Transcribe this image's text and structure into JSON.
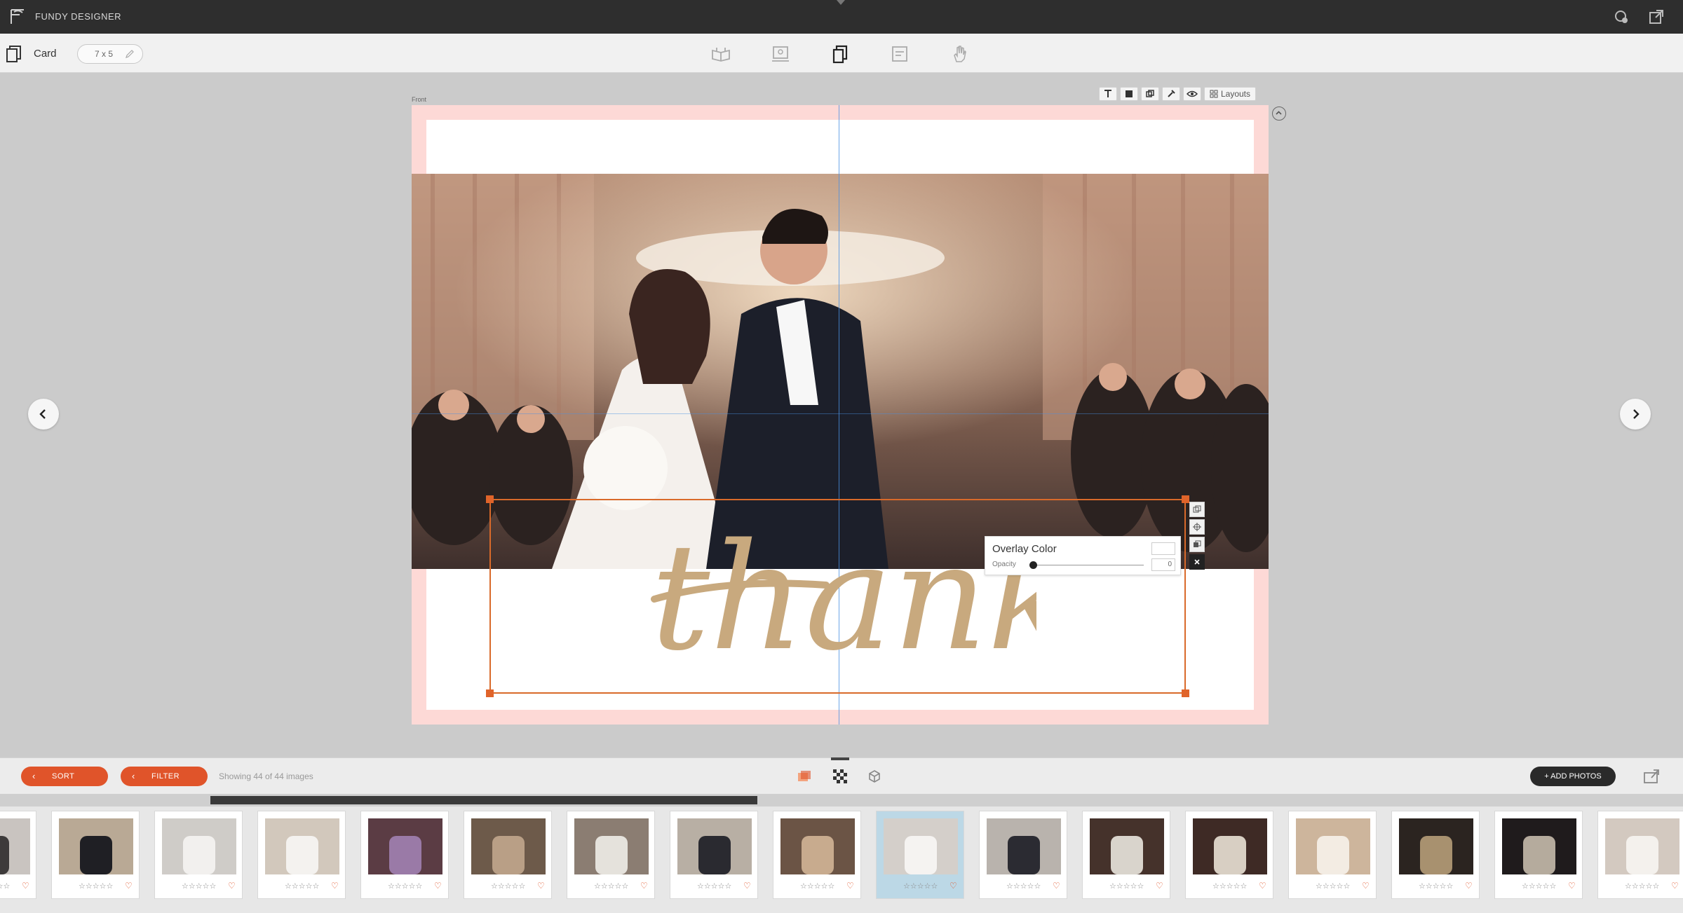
{
  "app": {
    "name": "FUNDY DESIGNER"
  },
  "toolbar": {
    "document_type": "Card",
    "size": "7 x 5",
    "modes": [
      "album-icon",
      "wall-art-icon",
      "card-icon",
      "gallery-icon",
      "hand-icon"
    ],
    "active_mode_index": 2
  },
  "canvas": {
    "side_label": "Front",
    "layouts_label": "Layouts",
    "text_overlay": "thanks"
  },
  "overlay_panel": {
    "title": "Overlay Color",
    "opacity_label": "Opacity",
    "opacity_value": "0"
  },
  "filmstrip_bar": {
    "sort_label": "SORT",
    "filter_label": "FILTER",
    "showing_text": "Showing 44 of 44 images",
    "add_photos_label": "+ ADD PHOTOS",
    "scroll_progress": 0.325
  },
  "thumbnails": {
    "selected_index": 9,
    "rating_stars": "☆☆☆☆☆",
    "items": [
      {
        "subject": "partial",
        "colors": [
          "#c9c4c0",
          "#3d3a3a"
        ]
      },
      {
        "subject": "groomsmen",
        "colors": [
          "#b9a995",
          "#1f1f24"
        ]
      },
      {
        "subject": "bridesmaids",
        "colors": [
          "#cfccc8",
          "#f2f0ee"
        ]
      },
      {
        "subject": "bride-portrait",
        "colors": [
          "#d2c8bc",
          "#f4f2ef"
        ]
      },
      {
        "subject": "ceremony-hall",
        "colors": [
          "#5b3c44",
          "#9a7aa7"
        ]
      },
      {
        "subject": "aisle",
        "colors": [
          "#6d5a4a",
          "#b99f86"
        ]
      },
      {
        "subject": "altar",
        "colors": [
          "#8b7d72",
          "#e5e2dc"
        ]
      },
      {
        "subject": "couple-aisle",
        "colors": [
          "#b8afa4",
          "#2a2a30"
        ]
      },
      {
        "subject": "reception-room",
        "colors": [
          "#6b5445",
          "#c8ab8e"
        ]
      },
      {
        "subject": "couple-window",
        "colors": [
          "#d4cfca",
          "#f5f3f1"
        ]
      },
      {
        "subject": "couple-exit",
        "colors": [
          "#b9b3ad",
          "#2b2b32"
        ]
      },
      {
        "subject": "couple-doorway",
        "colors": [
          "#45322b",
          "#d9d4cc"
        ]
      },
      {
        "subject": "family-group",
        "colors": [
          "#3e2a25",
          "#d8cfc3"
        ]
      },
      {
        "subject": "cake",
        "colors": [
          "#cdb59c",
          "#f3ece3"
        ]
      },
      {
        "subject": "stairs",
        "colors": [
          "#2b2420",
          "#a8916f"
        ]
      },
      {
        "subject": "couple-night",
        "colors": [
          "#1f1b1c",
          "#b5ab9d"
        ]
      },
      {
        "subject": "bride-dress",
        "colors": [
          "#d3c9c0",
          "#f4f1ed"
        ]
      }
    ]
  },
  "colors": {
    "accent": "#e0542a",
    "card_border": "#fdd9d6",
    "script_text": "#c8a97e",
    "guide": "#4a90e2"
  }
}
